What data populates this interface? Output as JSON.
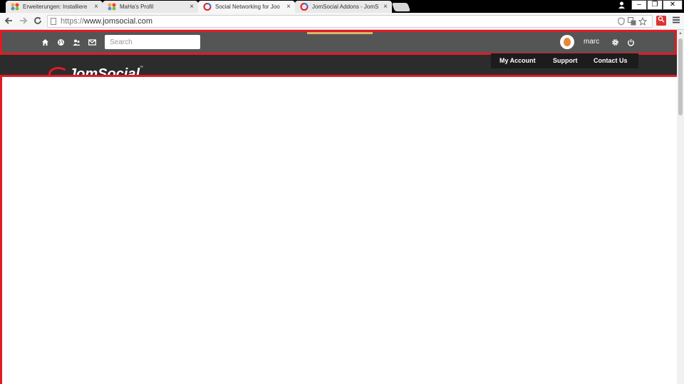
{
  "browser": {
    "tabs": [
      {
        "title": "Erweiterungen: Installiere",
        "active": false
      },
      {
        "title": "MaHa's Profil",
        "active": false
      },
      {
        "title": "Social Networking for Joo",
        "active": true
      },
      {
        "title": "JomSocial Addons - JomS",
        "active": false
      }
    ],
    "close_glyph": "×",
    "window_controls": {
      "minimize": "–",
      "restore": "❐",
      "close": "✕"
    },
    "url_proto": "https://",
    "url_host": "www.jomsocial.com"
  },
  "site": {
    "toolbar_icons": [
      "home-icon",
      "globe-icon",
      "people-icon",
      "mail-icon"
    ],
    "search_placeholder": "Search",
    "username": "marc",
    "nav": [
      "My Account",
      "Support",
      "Contact Us"
    ],
    "logo_text": "JomSocial"
  },
  "colors": {
    "highlight": "#e01b24",
    "toolbar_bg": "#555555",
    "header_bg": "#2c2c2c",
    "accent": "#d6b76a"
  }
}
